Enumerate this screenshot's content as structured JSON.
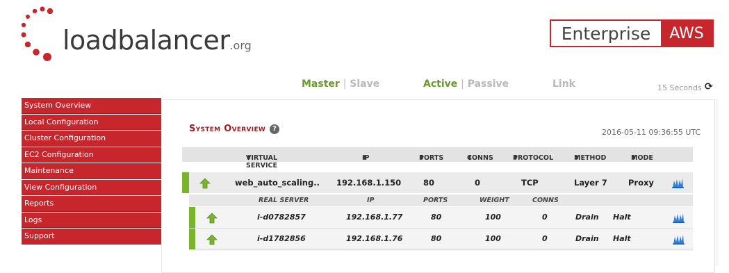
{
  "logo": {
    "main": "loadbalancer",
    "suffix": ".org",
    "dots_color": "#c8262d"
  },
  "badge": {
    "left": "Enterprise",
    "right": "AWS",
    "color": "#c8262d"
  },
  "status": {
    "master": "Master",
    "sep1": "|",
    "slave": "Slave",
    "active": "Active",
    "sep2": "|",
    "passive": "Passive",
    "link": "Link",
    "refresh_text": "15 Seconds",
    "active_color": "#6b9a2c"
  },
  "sidebar": {
    "items": [
      {
        "label": "System Overview"
      },
      {
        "label": "Local Configuration"
      },
      {
        "label": "Cluster Configuration"
      },
      {
        "label": "EC2 Configuration"
      },
      {
        "label": "Maintenance"
      },
      {
        "label": "View Configuration"
      },
      {
        "label": "Reports"
      },
      {
        "label": "Logs"
      },
      {
        "label": "Support"
      }
    ]
  },
  "main": {
    "title": "System Overview",
    "help": "?",
    "timestamp": "2016-05-11 09:36:55 UTC",
    "columns": {
      "virtual_service": "VIRTUAL SERVICE",
      "ip": "IP",
      "ports": "PORTS",
      "conns": "CONNS",
      "protocol": "PROTOCOL",
      "method": "METHOD",
      "mode": "MODE",
      "sort_glyph": "⬍"
    },
    "virtual_service": {
      "name": "web_auto_scaling..",
      "ip": "192.168.1.150",
      "ports": "80",
      "conns": "0",
      "protocol": "TCP",
      "method": "Layer 7",
      "mode": "Proxy",
      "status_color": "#7ab32e"
    },
    "rs_columns": {
      "real_server": "REAL SERVER",
      "ip": "IP",
      "ports": "PORTS",
      "weight": "WEIGHT",
      "conns": "CONNS"
    },
    "real_servers": [
      {
        "name": "i-d0782857",
        "ip": "192.168.1.77",
        "ports": "80",
        "weight": "100",
        "conns": "0",
        "drain": "Drain",
        "halt": "Halt"
      },
      {
        "name": "i-d1782856",
        "ip": "192.168.1.76",
        "ports": "80",
        "weight": "100",
        "conns": "0",
        "drain": "Drain",
        "halt": "Halt"
      }
    ]
  }
}
